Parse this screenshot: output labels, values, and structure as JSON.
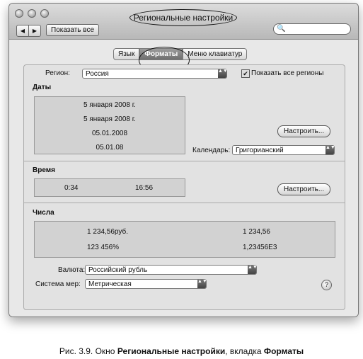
{
  "window": {
    "title": "Региональные настройки",
    "show_all": "Показать все",
    "back": "◀",
    "forward": "▶",
    "search_icon": "🔍"
  },
  "tabs": [
    {
      "label": "Язык"
    },
    {
      "label": "Форматы",
      "active": true
    },
    {
      "label": "Меню клавиатур"
    }
  ],
  "region": {
    "label": "Регион:",
    "value": "Россия",
    "show_all_label": "Показать все регионы",
    "show_all_checked": true
  },
  "dates": {
    "heading": "Даты",
    "lines": [
      "5 января 2008 г.",
      "5 января 2008 г.",
      "05.01.2008",
      "05.01.08"
    ],
    "customize": "Настроить...",
    "calendar_label": "Календарь:",
    "calendar_value": "Григорианский"
  },
  "time": {
    "heading": "Время",
    "short": "0:34",
    "long": "16:56",
    "customize": "Настроить..."
  },
  "numbers": {
    "heading": "Числа",
    "currency": "1 234,56руб.",
    "number": "1 234,56",
    "percent": "123 456%",
    "scientific": "1,23456E3"
  },
  "currency": {
    "label": "Валюта:",
    "value": "Российский рубль"
  },
  "measure": {
    "label": "Система мер:",
    "value": "Метрическая"
  },
  "caption": {
    "prefix": "Рис. 3.9.",
    "text1": " Окно ",
    "window": "Региональные настройки",
    "text2": ", вкладка ",
    "tab": "Форматы"
  },
  "help_icon": "?",
  "arrows": "▲▼",
  "check_mark": "✔"
}
